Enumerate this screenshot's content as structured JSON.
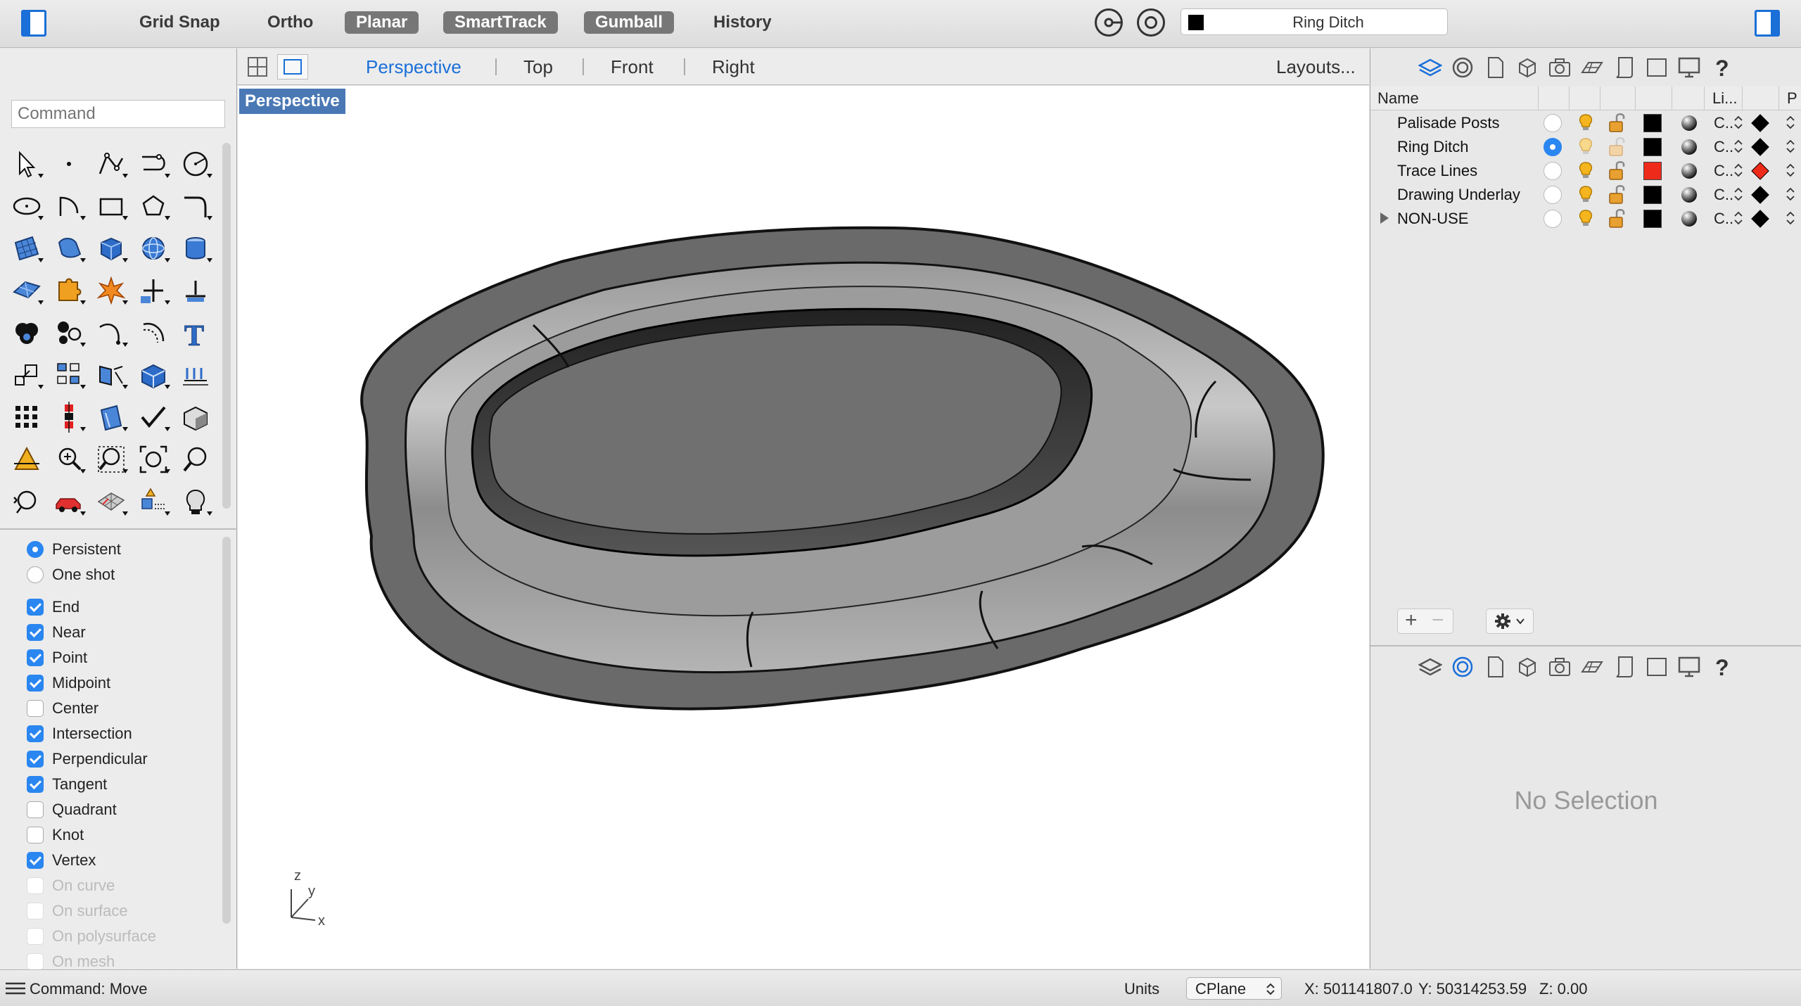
{
  "toolbar": {
    "modes": [
      {
        "label": "Grid Snap",
        "on": false
      },
      {
        "label": "Ortho",
        "on": false
      },
      {
        "label": "Planar",
        "on": true
      },
      {
        "label": "SmartTrack",
        "on": true
      },
      {
        "label": "Gumball",
        "on": true
      },
      {
        "label": "History",
        "on": false
      }
    ],
    "current_layer": "Ring Ditch",
    "current_layer_color": "#000000"
  },
  "command": {
    "placeholder": "Command",
    "status": "Command: Move"
  },
  "tools": [
    "select-arrow-icon",
    "point-icon",
    "polyline-icon",
    "curve-icon",
    "circle-icon",
    "ellipse-icon",
    "arc-icon",
    "rectangle-icon",
    "polygon-icon",
    "fillet-curve-icon",
    "surface-corner-icon",
    "extrude-surface-icon",
    "box-icon",
    "sphere-icon",
    "cylinder-icon",
    "surface-edit-icon",
    "puzzle-icon",
    "explode-icon",
    "trim-icon",
    "split-icon",
    "boolean-union-icon",
    "group-icon",
    "curve-from-object-icon",
    "offset-icon",
    "text-icon",
    "scale-icon",
    "array-icon",
    "mirror-icon",
    "solid-edit-icon",
    "dimension-icon",
    "grid-array-icon",
    "align-icon",
    "analyze-icon",
    "check-icon",
    "shade-icon",
    "cplane-icon",
    "zoom-window-icon",
    "zoom-selected-icon",
    "zoom-extents-icon",
    "zoom-icon",
    "pan-icon",
    "car-render-icon",
    "mesh-icon",
    "named-position-icon",
    "light-bulb-icon"
  ],
  "osnap": {
    "mode": [
      {
        "label": "Persistent",
        "on": true
      },
      {
        "label": "One shot",
        "on": false
      }
    ],
    "items": [
      {
        "label": "End",
        "on": true,
        "enabled": true
      },
      {
        "label": "Near",
        "on": true,
        "enabled": true
      },
      {
        "label": "Point",
        "on": true,
        "enabled": true
      },
      {
        "label": "Midpoint",
        "on": true,
        "enabled": true
      },
      {
        "label": "Center",
        "on": false,
        "enabled": true
      },
      {
        "label": "Intersection",
        "on": true,
        "enabled": true
      },
      {
        "label": "Perpendicular",
        "on": true,
        "enabled": true
      },
      {
        "label": "Tangent",
        "on": true,
        "enabled": true
      },
      {
        "label": "Quadrant",
        "on": false,
        "enabled": true
      },
      {
        "label": "Knot",
        "on": false,
        "enabled": true
      },
      {
        "label": "Vertex",
        "on": true,
        "enabled": true
      },
      {
        "label": "On curve",
        "on": false,
        "enabled": false
      },
      {
        "label": "On surface",
        "on": false,
        "enabled": false
      },
      {
        "label": "On polysurface",
        "on": false,
        "enabled": false
      },
      {
        "label": "On mesh",
        "on": false,
        "enabled": false
      }
    ]
  },
  "viewports": {
    "tabs": [
      "Perspective",
      "Top",
      "Front",
      "Right"
    ],
    "active": "Perspective",
    "layouts_label": "Layouts...",
    "viewport_label": "Perspective",
    "axis_labels": {
      "z": "z",
      "y": "y",
      "x": "x"
    }
  },
  "layers": {
    "columns": {
      "name": "Name",
      "linetype": "Li...",
      "print": "P"
    },
    "rows": [
      {
        "name": "Palisade Posts",
        "current": false,
        "color": "#000000",
        "linetype": "C..",
        "print_color": "#000000",
        "expandable": false
      },
      {
        "name": "Ring Ditch",
        "current": true,
        "color": "#000000",
        "linetype": "C..",
        "print_color": "#000000",
        "expandable": false
      },
      {
        "name": "Trace Lines",
        "current": false,
        "color": "#ee2a1a",
        "linetype": "C..",
        "print_color": "#ee2a1a",
        "expandable": false
      },
      {
        "name": "Drawing Underlay",
        "current": false,
        "color": "#000000",
        "linetype": "C..",
        "print_color": "#000000",
        "expandable": false
      },
      {
        "name": "NON-USE",
        "current": false,
        "color": "#000000",
        "linetype": "C..",
        "print_color": "#000000",
        "expandable": true
      }
    ],
    "add_label": "+",
    "remove_label": "−"
  },
  "properties": {
    "empty_text": "No Selection"
  },
  "status": {
    "units_label": "Units",
    "cplane_label": "CPlane",
    "x": "X: 501141807.0",
    "y": "Y: 50314253.59",
    "z": "Z: 0.00"
  },
  "colors": {
    "accent": "#1a6fd8",
    "viewport_label_bg": "#4a78b5",
    "model_outer": "#6a6a6a",
    "model_inner": "#707070"
  }
}
